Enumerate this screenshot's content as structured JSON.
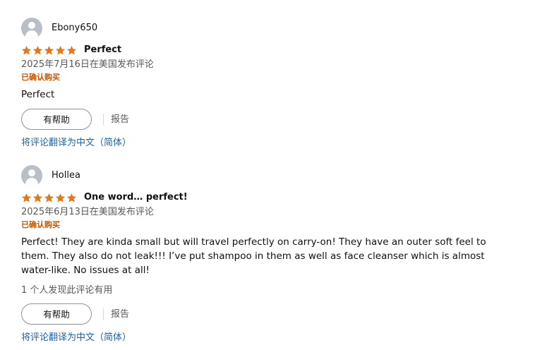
{
  "colors": {
    "star": "#de7921",
    "verified": "#c45500",
    "link": "#2162a1",
    "muted": "#565959"
  },
  "reviews": [
    {
      "user": "Ebony650",
      "rating": 5,
      "title": "Perfect",
      "date": "2025年7月16日在美国发布评论",
      "verified": "已确认购买",
      "body": "Perfect",
      "helpful_count": "",
      "helpful_label": "有帮助",
      "report_label": "报告",
      "translate_label": "将评论翻译为中文（简体）"
    },
    {
      "user": "Hollea",
      "rating": 5,
      "title": "One word… perfect!",
      "date": "2025年6月13日在美国发布评论",
      "verified": "已确认购买",
      "body": "Perfect! They are kinda small but will travel perfectly on carry-on! They have an outer soft feel to them. They also do not leak!!! I’ve put shampoo in them as well as face cleanser which is almost water-like. No issues at all!",
      "helpful_count": "1 个人发现此评论有用",
      "helpful_label": "有帮助",
      "report_label": "报告",
      "translate_label": "将评论翻译为中文（简体）"
    }
  ]
}
